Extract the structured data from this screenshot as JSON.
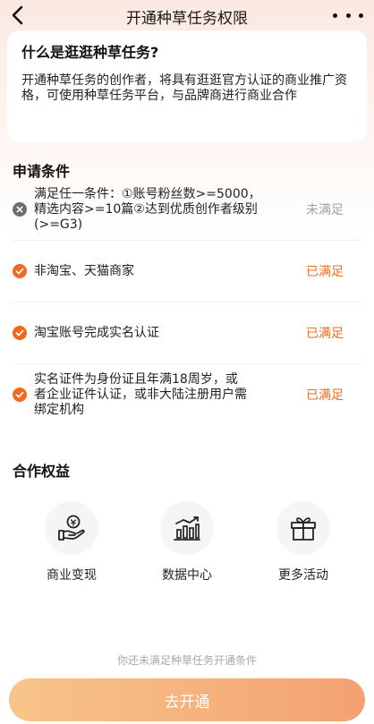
{
  "header": {
    "title": "开通种草任务权限",
    "back_icon": "chevron-left-icon",
    "more_icon": "more-dots-icon"
  },
  "intro": {
    "title": "什么是逛逛种草任务?",
    "body": "开通种草任务的创作者，将具有逛逛官方认证的商业推广资格，可使用种草任务平台，与品牌商进行商业合作"
  },
  "conditions": {
    "title": "申请条件",
    "items": [
      {
        "text": "满足任一条件：①账号粉丝数>=5000，精选内容>=10篇②达到优质创作者级别(>=G3)",
        "status": "未满足",
        "met": false
      },
      {
        "text": "非淘宝、天猫商家",
        "status": "已满足",
        "met": true
      },
      {
        "text": "淘宝账号完成实名认证",
        "status": "已满足",
        "met": true
      },
      {
        "text": "实名证件为身份证且年满18周岁，或者企业证件认证，或非大陆注册用户需绑定机构",
        "status": "已满足",
        "met": true
      }
    ]
  },
  "benefits": {
    "title": "合作权益",
    "items": [
      {
        "label": "商业变现",
        "icon": "money-hand-icon"
      },
      {
        "label": "数据中心",
        "icon": "bar-chart-icon"
      },
      {
        "label": "更多活动",
        "icon": "gift-icon"
      }
    ]
  },
  "footer": {
    "notice": "你还未满足种草任务开通条件",
    "button": "去开通"
  },
  "colors": {
    "accent": "#f06b1f",
    "muted": "#a3a3a3",
    "button_start": "#f7c58a",
    "button_end": "#f4a173"
  }
}
